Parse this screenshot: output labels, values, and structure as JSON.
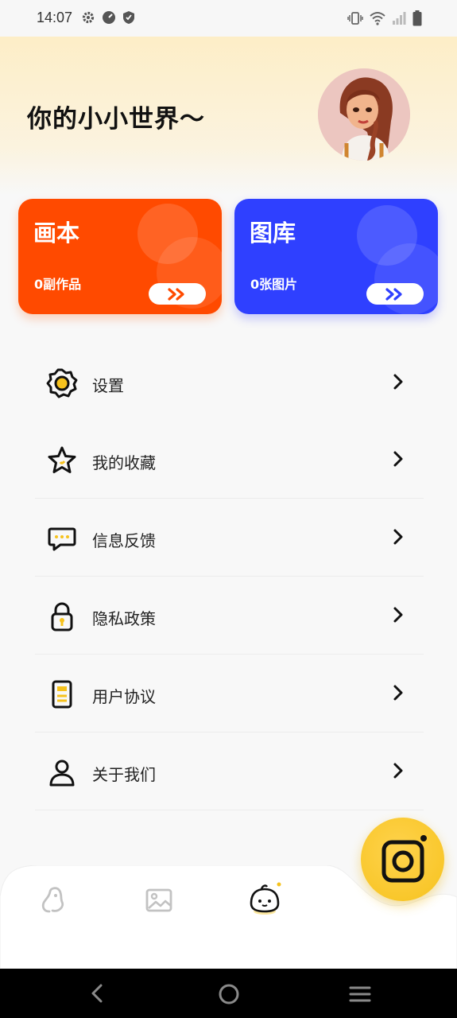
{
  "status_bar": {
    "time": "14:07"
  },
  "header": {
    "title": "你的小小世界～"
  },
  "cards": {
    "draw": {
      "title": "画本",
      "subtitle": "0副作品"
    },
    "gallery": {
      "title": "图库",
      "subtitle": "0张图片"
    }
  },
  "menu": [
    {
      "label": "设置",
      "icon": "gear-icon"
    },
    {
      "label": "我的收藏",
      "icon": "star-icon"
    },
    {
      "label": "信息反馈",
      "icon": "chat-icon"
    },
    {
      "label": "隐私政策",
      "icon": "lock-icon"
    },
    {
      "label": "用户协议",
      "icon": "document-icon"
    },
    {
      "label": "关于我们",
      "icon": "person-icon"
    }
  ],
  "tabs": [
    {
      "name": "home",
      "icon": "doodle-icon"
    },
    {
      "name": "gallery",
      "icon": "image-icon"
    },
    {
      "name": "me",
      "icon": "bun-face-icon",
      "active": true
    }
  ],
  "colors": {
    "draw_card": "#ff4a00",
    "gallery_card": "#2f40ff",
    "fab": "#f6c21d",
    "accent_yellow": "#f6c21d"
  }
}
